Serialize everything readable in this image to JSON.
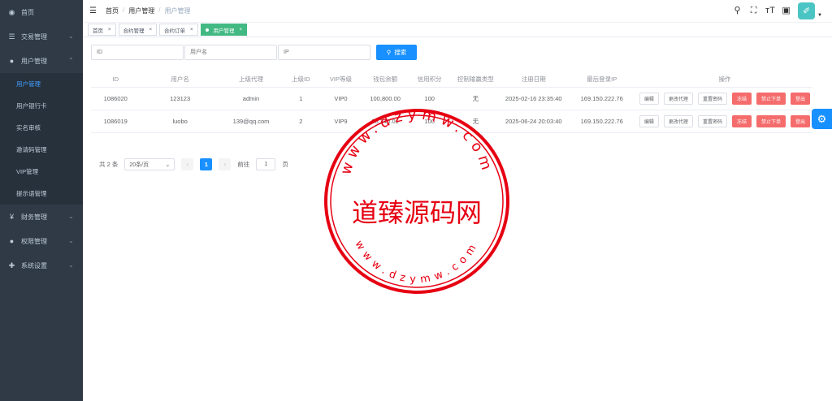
{
  "sidebar": {
    "items": [
      {
        "label": "首页",
        "icon": "dashboard-icon"
      },
      {
        "label": "交易管理",
        "icon": "list-icon"
      },
      {
        "label": "用户管理",
        "icon": "user-icon"
      },
      {
        "label": "财务管理",
        "icon": "yen-icon"
      },
      {
        "label": "权限管理",
        "icon": "user-icon"
      },
      {
        "label": "系统设置",
        "icon": "plus-icon"
      }
    ],
    "subitems": [
      "用户管理",
      "用户银行卡",
      "实名审核",
      "邀请码管理",
      "VIP管理",
      "提示语管理"
    ]
  },
  "header": {
    "breadcrumb": [
      "首页",
      "用户管理",
      "用户管理"
    ],
    "avatar_glyph": "✐"
  },
  "tags": [
    {
      "label": "首页"
    },
    {
      "label": "合约管理"
    },
    {
      "label": "合约订单"
    },
    {
      "label": "用户管理"
    }
  ],
  "search": {
    "id_placeholder": "ID",
    "username_placeholder": "用户名",
    "ip_placeholder": "IP",
    "button_label": "搜索"
  },
  "table": {
    "headers": [
      "ID",
      "用户名",
      "上级代理",
      "上级ID",
      "VIP等级",
      "钱包余额",
      "信用积分",
      "控制输赢类型",
      "注册日期",
      "最后登录IP",
      "操作"
    ],
    "rows": [
      {
        "id": "1086020",
        "username": "123123",
        "agent": "admin",
        "agent_id": "1",
        "vip": "VIP0",
        "balance": "100,800.00",
        "credit": "100",
        "control": "无",
        "date": "2025-02-16 23:35:40",
        "ip": "169.150.222.76"
      },
      {
        "id": "1086019",
        "username": "luobo",
        "agent": "139@qq.com",
        "agent_id": "2",
        "vip": "VIP9",
        "balance": "98,340.01",
        "credit": "100",
        "control": "无",
        "date": "2025-06-24 20:03:40",
        "ip": "169.150.222.76"
      }
    ],
    "actions": [
      "编辑",
      "更改代理",
      "重置密码",
      "冻结",
      "禁止下单",
      "登出"
    ]
  },
  "pagination": {
    "total_text": "共 2 条",
    "page_size": "20条/页",
    "current_page": "1",
    "goto_label": "前往",
    "goto_value": "1",
    "page_unit": "页"
  },
  "watermark": {
    "center_text": "道臻源码网",
    "ring_top": "www.dzymw.com",
    "ring_bottom": "www.dzymw.com"
  },
  "colors": {
    "sidebar_bg": "#2f3a46",
    "accent": "#1890ff",
    "danger": "#f56c6c",
    "active_tag": "#42b983",
    "stamp": "#e60012"
  }
}
